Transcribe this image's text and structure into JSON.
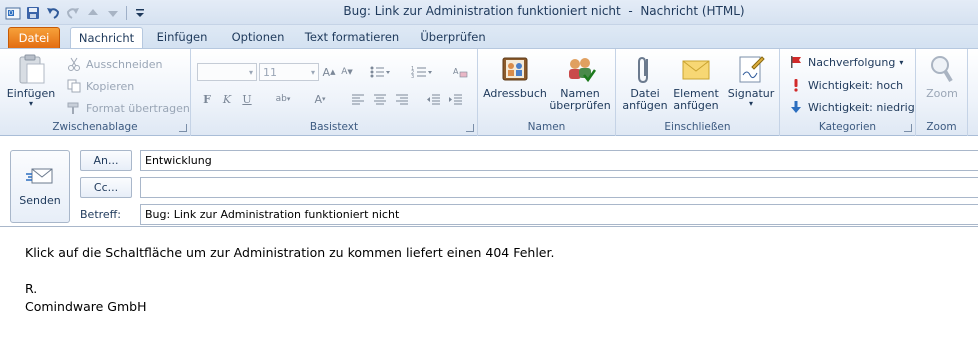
{
  "window": {
    "title": "Bug: Link zur Administration funktioniert nicht  -  Nachricht (HTML)"
  },
  "qat": {
    "icons": [
      "outlook-app-icon",
      "save-icon",
      "undo-icon",
      "redo-icon",
      "up-arrow-icon",
      "down-arrow-icon",
      "customize-icon"
    ]
  },
  "tabs": [
    {
      "label": "Datei"
    },
    {
      "label": "Nachricht"
    },
    {
      "label": "Einfügen"
    },
    {
      "label": "Optionen"
    },
    {
      "label": "Text formatieren"
    },
    {
      "label": "Überprüfen"
    }
  ],
  "ribbon": {
    "clipboard": {
      "label": "Zwischenablage",
      "paste": "Einfügen",
      "cut": "Ausschneiden",
      "copy": "Kopieren",
      "format_painter": "Format übertragen"
    },
    "basic_text": {
      "label": "Basistext",
      "font_name": "",
      "font_size": "11"
    },
    "names": {
      "label": "Namen",
      "address_book": "Adressbuch",
      "check_names_line1": "Namen",
      "check_names_line2": "überprüfen"
    },
    "include": {
      "label": "Einschließen",
      "attach_file_line1": "Datei",
      "attach_file_line2": "anfügen",
      "attach_item_line1": "Element",
      "attach_item_line2": "anfügen",
      "signature": "Signatur"
    },
    "tags": {
      "label": "Kategorien",
      "follow_up": "Nachverfolgung",
      "high_importance": "Wichtigkeit: hoch",
      "low_importance": "Wichtigkeit: niedrig"
    },
    "zoom": {
      "label": "Zoom",
      "zoom_button": "Zoom"
    }
  },
  "compose": {
    "send_label": "Senden",
    "to_label": "An...",
    "cc_label": "Cc...",
    "subject_label": "Betreff:",
    "to_value": "Entwicklung",
    "cc_value": "",
    "subject_value": "Bug: Link zur Administration funktioniert nicht"
  },
  "body": {
    "line1": "Klick auf die Schaltfläche um zur Administration zu kommen liefert einen 404 Fehler.",
    "line2": "R.",
    "line3": "Comindware GmbH"
  },
  "colors": {
    "file_tab": "#e26a10",
    "ribbon_text": "#1e395b",
    "disabled_text": "#9aa6b6"
  }
}
